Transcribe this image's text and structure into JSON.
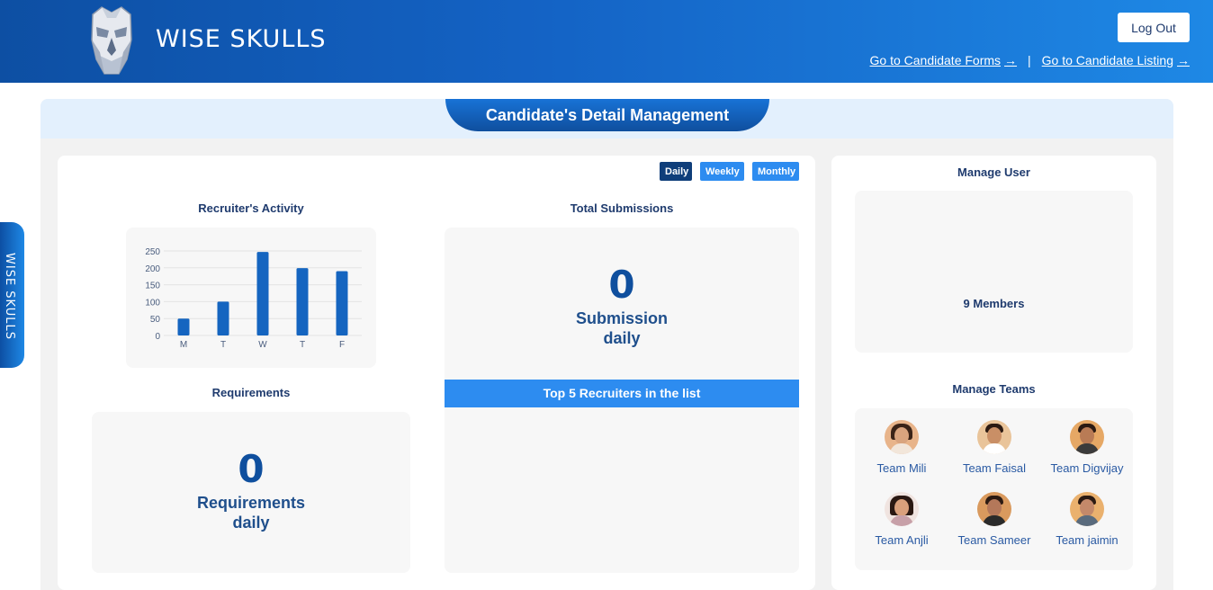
{
  "header": {
    "brand": "WISE SKULLS",
    "logout_label": "Log Out",
    "nav": {
      "candidate_forms": "Go to Candidate Forms",
      "separator": "|",
      "candidate_listing": "Go to Candidate Listing",
      "arrow": "→"
    }
  },
  "side_tab": {
    "label": "WISE SKULLS"
  },
  "panel": {
    "title": "Candidate's Detail Management"
  },
  "period_filters": [
    "Daily",
    "Weekly",
    "Monthly"
  ],
  "recruiters_activity": {
    "title": "Recruiter's Activity"
  },
  "requirements": {
    "title": "Requirements",
    "count": "0",
    "caption_line1": "Requirements",
    "caption_line2": "daily"
  },
  "submissions": {
    "title": "Total Submissions",
    "count": "0",
    "caption_line1": "Submission",
    "caption_line2": "daily",
    "top5_label": "Top 5 Recruiters in the list"
  },
  "manage_user": {
    "title": "Manage User",
    "members": "9 Members"
  },
  "manage_teams": {
    "title": "Manage Teams",
    "teams": [
      {
        "name": "Team Mili"
      },
      {
        "name": "Team Faisal"
      },
      {
        "name": "Team Digvijay"
      },
      {
        "name": "Team Anjli"
      },
      {
        "name": "Team Sameer"
      },
      {
        "name": "Team jaimin"
      }
    ]
  },
  "colors": {
    "primary": "#0f4f9e",
    "accent": "#2d8cf0",
    "bar": "#1565c0"
  },
  "chart_data": {
    "type": "bar",
    "categories": [
      "M",
      "T",
      "W",
      "T",
      "F"
    ],
    "values": [
      50,
      100,
      247,
      199,
      190
    ],
    "title": "Recruiter's Activity",
    "xlabel": "",
    "ylabel": "",
    "ylim": [
      0,
      250
    ],
    "yticks": [
      0,
      50,
      100,
      150,
      200,
      250
    ],
    "grid": true,
    "legend": "none"
  }
}
